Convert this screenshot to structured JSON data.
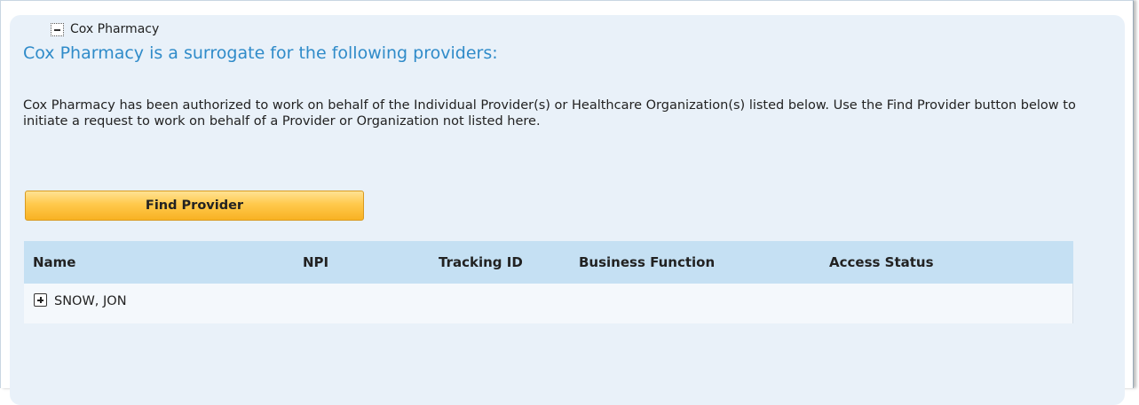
{
  "section": {
    "title": "Cox Pharmacy",
    "heading": "Cox Pharmacy is a surrogate for the following providers:",
    "description": "Cox Pharmacy has been authorized to work on behalf of the Individual Provider(s) or Healthcare Organization(s) listed below. Use the Find Provider button below to initiate a request to work on behalf of a Provider or Organization not listed here."
  },
  "actions": {
    "find_provider_label": "Find Provider"
  },
  "table": {
    "columns": [
      "Name",
      "NPI",
      "Tracking ID",
      "Business Function",
      "Access Status"
    ],
    "rows": [
      {
        "name": "SNOW, JON",
        "npi": "",
        "tracking_id": "",
        "business_function": "",
        "access_status": ""
      }
    ]
  },
  "icons": {
    "collapse": "minus-box-icon",
    "expand": "plus-box-icon"
  },
  "colors": {
    "heading": "#2f8bc9",
    "panel_bg": "#e9f1f9",
    "table_header_bg": "#c5e0f3",
    "button_gradient_top": "#ffe293",
    "button_gradient_bottom": "#f8b223"
  }
}
